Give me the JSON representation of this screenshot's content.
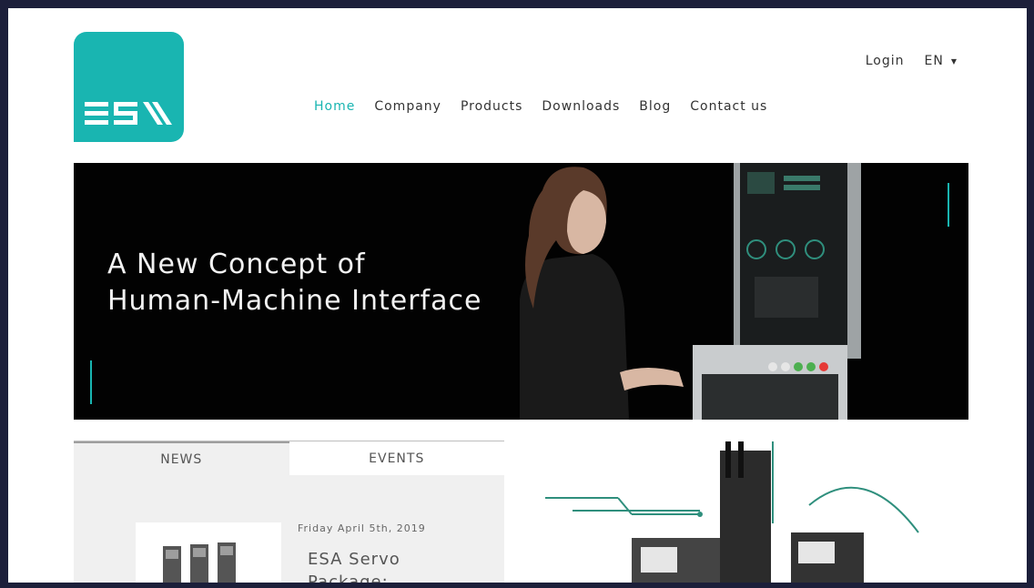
{
  "brand": {
    "logo_text": "ES\\",
    "color": "#19b5b1"
  },
  "topbar": {
    "login": "Login",
    "language": "EN"
  },
  "nav": {
    "items": [
      {
        "label": "Home",
        "active": true
      },
      {
        "label": "Company",
        "active": false
      },
      {
        "label": "Products",
        "active": false
      },
      {
        "label": "Downloads",
        "active": false
      },
      {
        "label": "Blog",
        "active": false
      },
      {
        "label": "Contact us",
        "active": false
      }
    ]
  },
  "hero": {
    "line1": "A New Concept of",
    "line2": "Human-Machine Interface"
  },
  "tabs": [
    {
      "label": "NEWS",
      "active": true
    },
    {
      "label": "EVENTS",
      "active": false
    }
  ],
  "news": {
    "date": "Friday April 5th, 2019",
    "title": "ESA Servo Package:"
  }
}
